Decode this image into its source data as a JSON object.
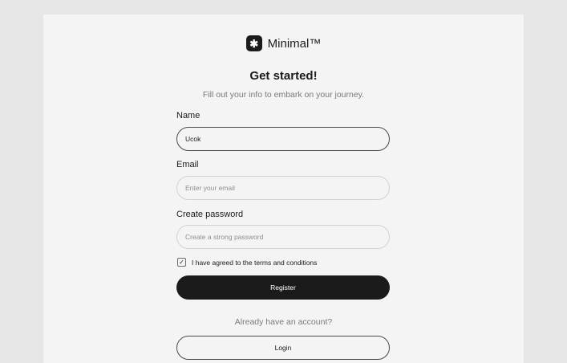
{
  "brand": {
    "logo_glyph": "✱",
    "name": "Minimal™"
  },
  "header": {
    "title": "Get started!",
    "subtitle": "Fill out your info to embark on your journey."
  },
  "form": {
    "name": {
      "label": "Name",
      "value": "Ucok",
      "placeholder": ""
    },
    "email": {
      "label": "Email",
      "value": "",
      "placeholder": "Enter your email"
    },
    "password": {
      "label": "Create password",
      "value": "",
      "placeholder": "Create a strong password"
    },
    "terms": {
      "checked": true,
      "check_glyph": "✓",
      "label": "I have agreed to the terms and conditions"
    },
    "register_label": "Register"
  },
  "footer": {
    "prompt": "Already have an account?",
    "login_label": "Login"
  },
  "colors": {
    "primary": "#1b1b1b",
    "page_background": "#e6e6e6",
    "card_background": "#f4f4f4",
    "muted_text": "#7a7a7a"
  }
}
